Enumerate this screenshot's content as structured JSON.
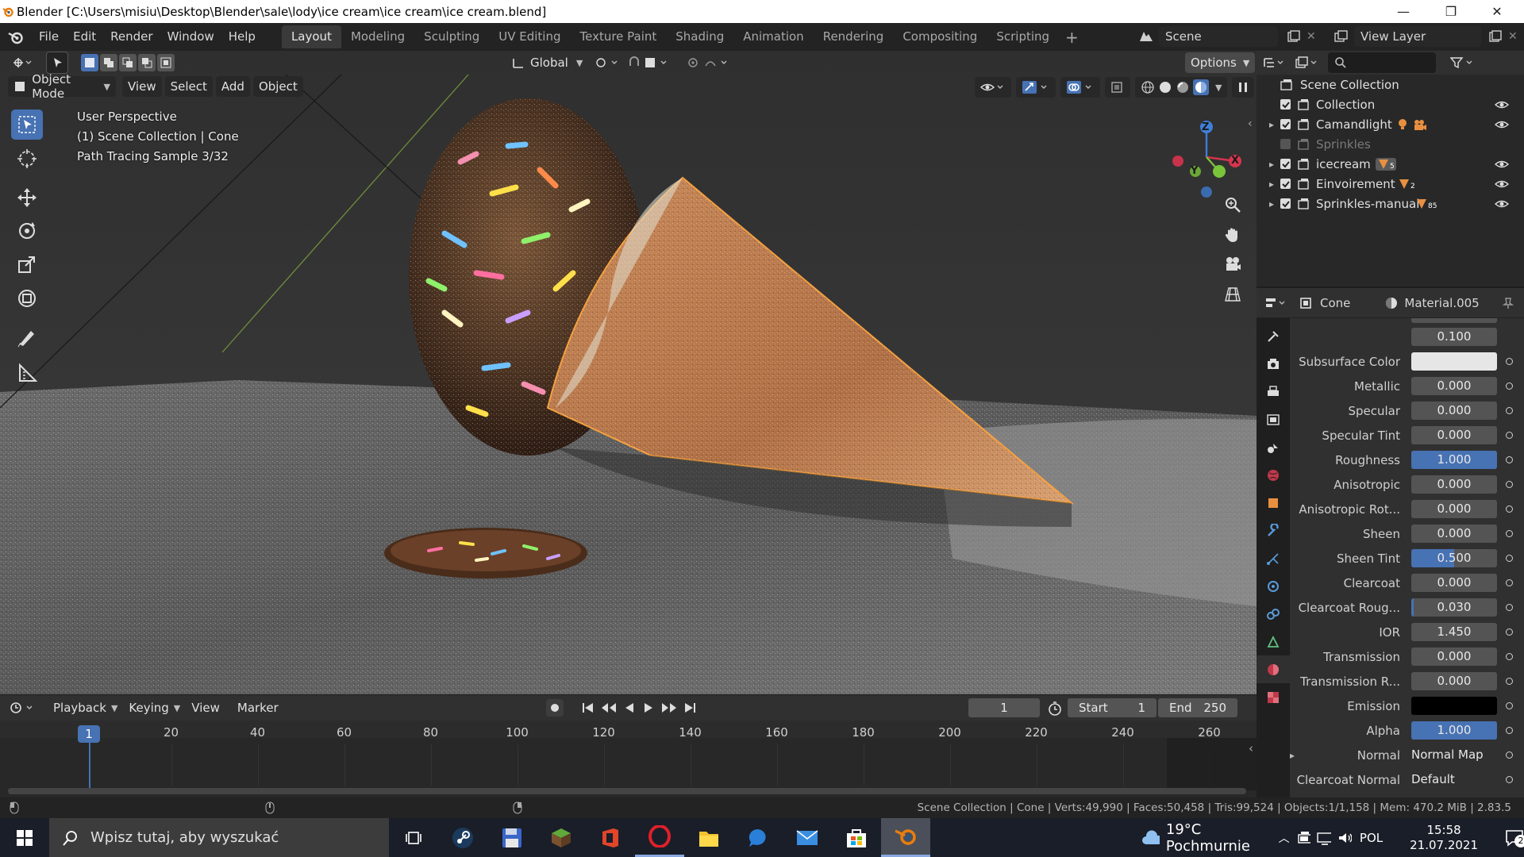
{
  "window": {
    "title": "Blender [C:\\Users\\misiu\\Desktop\\Blender\\sale\\lody\\ice cream\\ice cream\\ice cream.blend]",
    "minimize": "—",
    "maximize": "❐",
    "close": "✕"
  },
  "menus": [
    "File",
    "Edit",
    "Render",
    "Window",
    "Help"
  ],
  "workspaces": [
    "Layout",
    "Modeling",
    "Sculpting",
    "UV Editing",
    "Texture Paint",
    "Shading",
    "Animation",
    "Rendering",
    "Compositing",
    "Scripting"
  ],
  "active_workspace": "Layout",
  "scene": {
    "name": "Scene",
    "view_layer": "View Layer"
  },
  "viewport": {
    "mode": "Object Mode",
    "menus": [
      "View",
      "Select",
      "Add",
      "Object"
    ],
    "orientation": "Global",
    "options": "Options",
    "overlay_lines": [
      "User Perspective",
      "(1) Scene Collection | Cone",
      "Path Tracing Sample 3/32"
    ],
    "gizmo": {
      "z": "Z",
      "y": "Y",
      "x": "X"
    }
  },
  "outliner": {
    "root": "Scene Collection",
    "rows": [
      {
        "label": "Collection",
        "expand": "",
        "checked": true,
        "badge": ""
      },
      {
        "label": "Camandlight",
        "expand": "▸",
        "checked": true,
        "badge": ""
      },
      {
        "label": "Sprinkles",
        "expand": "",
        "checked": false,
        "badge": ""
      },
      {
        "label": "icecream",
        "expand": "▸",
        "checked": true,
        "badge": "5"
      },
      {
        "label": "Einvoirement",
        "expand": "▸",
        "checked": true,
        "badge": "2"
      },
      {
        "label": "Sprinkles-manual",
        "expand": "▸",
        "checked": true,
        "badge": "85"
      }
    ]
  },
  "properties": {
    "object": "Cone",
    "material": "Material.005",
    "partial_value": "0.100",
    "rows": [
      {
        "label": "Subsurface Color",
        "value": "",
        "kind": "color",
        "color": "#e6e6e6"
      },
      {
        "label": "Metallic",
        "value": "0.000",
        "fill": 0
      },
      {
        "label": "Specular",
        "value": "0.000",
        "fill": 0
      },
      {
        "label": "Specular Tint",
        "value": "0.000",
        "fill": 0
      },
      {
        "label": "Roughness",
        "value": "1.000",
        "fill": 1
      },
      {
        "label": "Anisotropic",
        "value": "0.000",
        "fill": 0
      },
      {
        "label": "Anisotropic Rot...",
        "value": "0.000",
        "fill": 0
      },
      {
        "label": "Sheen",
        "value": "0.000",
        "fill": 0
      },
      {
        "label": "Sheen Tint",
        "value": "0.500",
        "fill": 0.5
      },
      {
        "label": "Clearcoat",
        "value": "0.000",
        "fill": 0
      },
      {
        "label": "Clearcoat Roug...",
        "value": "0.030",
        "fill": 0.03
      },
      {
        "label": "IOR",
        "value": "1.450",
        "fill": 0
      },
      {
        "label": "Transmission",
        "value": "0.000",
        "fill": 0
      },
      {
        "label": "Transmission R...",
        "value": "0.000",
        "fill": 0
      },
      {
        "label": "Emission",
        "value": "",
        "kind": "color",
        "color": "#000000"
      },
      {
        "label": "Alpha",
        "value": "1.000",
        "fill": 1
      },
      {
        "label": "Normal",
        "value": "Normal Map",
        "kind": "link",
        "expand": "▸"
      },
      {
        "label": "Clearcoat Normal",
        "value": "Default",
        "kind": "link"
      }
    ]
  },
  "timeline": {
    "menus": [
      "Playback",
      "Keying",
      "View",
      "Marker"
    ],
    "current_frame": "1",
    "start_label": "Start",
    "start": "1",
    "end_label": "End",
    "end": "250",
    "ticks": [
      "20",
      "40",
      "60",
      "80",
      "100",
      "120",
      "140",
      "160",
      "180",
      "200",
      "220",
      "240",
      "260"
    ]
  },
  "statusbar": {
    "text": "Scene Collection | Cone | Verts:49,990 | Faces:50,458 | Tris:99,524 | Objects:1/1,158 | Mem: 470.2 MiB | 2.83.5"
  },
  "taskbar": {
    "search_placeholder": "Wpisz tutaj, aby wyszukać",
    "weather": "19°C Pochmurnie",
    "language": "POL",
    "time": "15:58",
    "date": "21.07.2021",
    "notifications": "2"
  },
  "colors": {
    "accent": "#4772b3",
    "selection": "#f5a040",
    "active_ws": "#3a3a3a"
  }
}
